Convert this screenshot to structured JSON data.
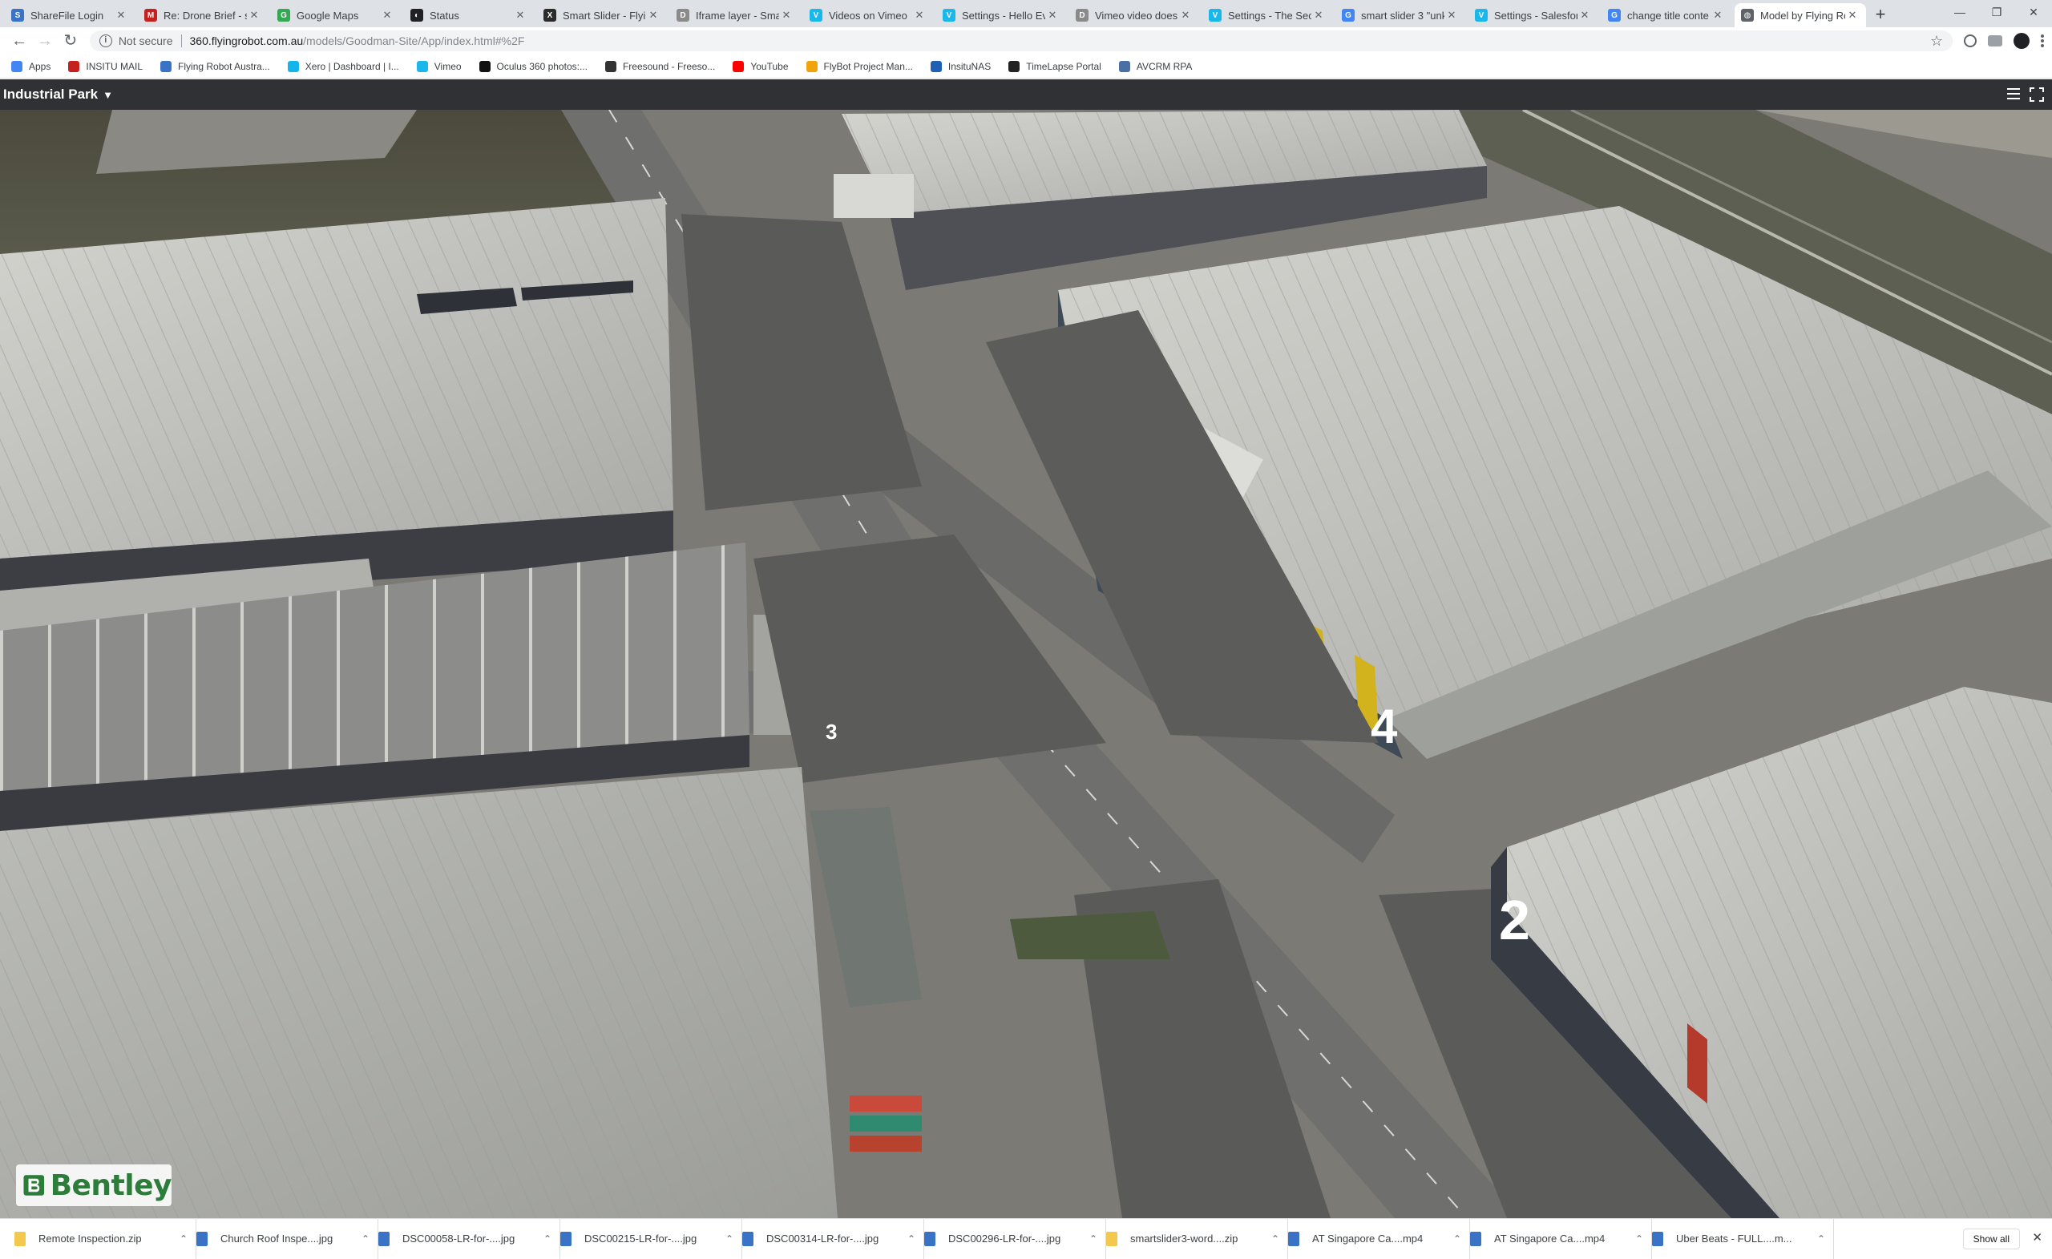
{
  "tabs": [
    {
      "title": "ShareFile Login",
      "fav": "S",
      "color": "#3a73c6",
      "icon": "sharefile-icon"
    },
    {
      "title": "Re: Drone Brief - su",
      "fav": "M",
      "color": "#c5221f",
      "icon": "gmail-icon"
    },
    {
      "title": "Google Maps",
      "fav": "G",
      "color": "#34a853",
      "icon": "maps-icon"
    },
    {
      "title": "Status",
      "fav": "◐",
      "color": "#202124",
      "icon": "status-icon"
    },
    {
      "title": "Smart Slider - Flying",
      "fav": "X",
      "color": "#2b2b2b",
      "icon": "smartslider-icon"
    },
    {
      "title": "Iframe layer - Smar",
      "fav": "D",
      "color": "#8a8a8a",
      "icon": "doc-icon"
    },
    {
      "title": "Videos on Vimeo",
      "fav": "V",
      "color": "#1ab7ea",
      "icon": "vimeo-icon"
    },
    {
      "title": "Settings - Hello Ev",
      "fav": "V",
      "color": "#1ab7ea",
      "icon": "vimeo-icon"
    },
    {
      "title": "Vimeo video doesn",
      "fav": "D",
      "color": "#8a8a8a",
      "icon": "doc-icon"
    },
    {
      "title": "Settings - The Seci",
      "fav": "V",
      "color": "#1ab7ea",
      "icon": "vimeo-icon"
    },
    {
      "title": "smart slider 3 \"unk",
      "fav": "G",
      "color": "#4285f4",
      "icon": "google-icon"
    },
    {
      "title": "Settings - Salesfor",
      "fav": "V",
      "color": "#1ab7ea",
      "icon": "vimeo-icon"
    },
    {
      "title": "change title conte",
      "fav": "G",
      "color": "#4285f4",
      "icon": "google-icon"
    },
    {
      "title": "Model by Flying Ro",
      "fav": "◍",
      "color": "#5f6368",
      "icon": "globe-icon",
      "active": true
    }
  ],
  "new_tab": "+",
  "window": {
    "minimize": "—",
    "maximize": "❐",
    "close": "✕"
  },
  "toolbar": {
    "not_secure": "Not secure",
    "url_host": "360.flyingrobot.com.au",
    "url_path": "/models/Goodman-Site/App/index.html#%2F"
  },
  "bookmarks": [
    {
      "label": "Apps",
      "color": "#4285f4",
      "icon": "apps-grid-icon"
    },
    {
      "label": "INSITU MAIL",
      "color": "#c5221f",
      "icon": "gmail-icon"
    },
    {
      "label": "Flying Robot Austra...",
      "color": "#3a73c6",
      "icon": "sharefile-icon"
    },
    {
      "label": "Xero | Dashboard | I...",
      "color": "#13b5ea",
      "icon": "xero-icon"
    },
    {
      "label": "Vimeo",
      "color": "#1ab7ea",
      "icon": "vimeo-icon"
    },
    {
      "label": "Oculus 360 photos:...",
      "color": "#111111",
      "icon": "oculus-icon"
    },
    {
      "label": "Freesound - Freeso...",
      "color": "#333333",
      "icon": "freesound-icon"
    },
    {
      "label": "YouTube",
      "color": "#ff0000",
      "icon": "youtube-icon"
    },
    {
      "label": "FlyBot Project Man...",
      "color": "#f0a30a",
      "icon": "flybot-icon"
    },
    {
      "label": "InsituNAS",
      "color": "#1f5fb4",
      "icon": "nas-icon"
    },
    {
      "label": "TimeLapse Portal",
      "color": "#222222",
      "icon": "timelapse-icon"
    },
    {
      "label": "AVCRM RPA",
      "color": "#4a6fa5",
      "icon": "avcrm-icon"
    }
  ],
  "viewer": {
    "title": "Industrial Park",
    "caret": "▼",
    "logo_text": "Bentley"
  },
  "scene_labels": {
    "building_3": "3",
    "building_2": "2",
    "building_4": "4"
  },
  "downloads": [
    {
      "name": "Remote Inspection.zip",
      "color": "#f2c94c"
    },
    {
      "name": "Church Roof Inspe....jpg",
      "color": "#3a73c6"
    },
    {
      "name": "DSC00058-LR-for-....jpg",
      "color": "#3a73c6"
    },
    {
      "name": "DSC00215-LR-for-....jpg",
      "color": "#3a73c6"
    },
    {
      "name": "DSC00314-LR-for-....jpg",
      "color": "#3a73c6"
    },
    {
      "name": "DSC00296-LR-for-....jpg",
      "color": "#3a73c6"
    },
    {
      "name": "smartslider3-word....zip",
      "color": "#f2c94c"
    },
    {
      "name": "AT Singapore Ca....mp4",
      "color": "#3a73c6"
    },
    {
      "name": "AT Singapore Ca....mp4",
      "color": "#3a73c6"
    },
    {
      "name": "Uber Beats - FULL....m...",
      "color": "#3a73c6"
    }
  ],
  "downloads_show_all": "Show all",
  "downloads_close": "✕"
}
